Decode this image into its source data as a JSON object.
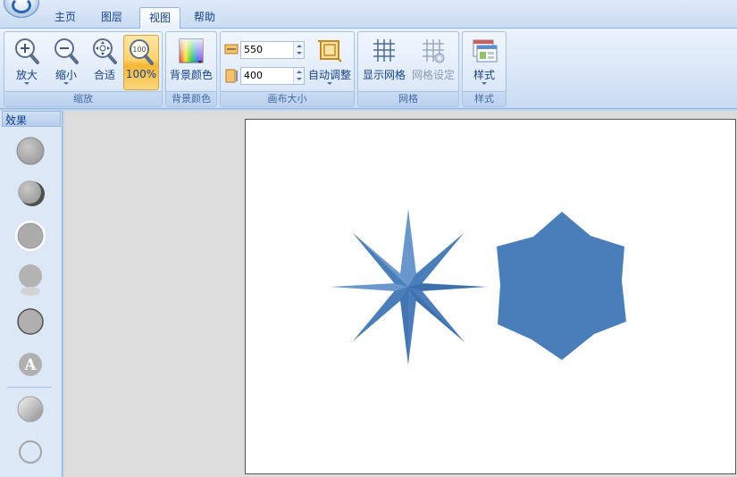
{
  "tabs": [
    {
      "label": "主页",
      "active": false
    },
    {
      "label": "图层",
      "active": false
    },
    {
      "label": "视图",
      "active": true
    },
    {
      "label": "帮助",
      "active": false
    }
  ],
  "ribbon": {
    "zoom_group": {
      "label": "缩放",
      "zoom_in": "放大",
      "zoom_out": "缩小",
      "fit": "合适",
      "actual": "100%"
    },
    "bg_group": {
      "label": "背景颜色",
      "button": "背景颜色"
    },
    "canvas_group": {
      "label": "画布大小",
      "width": "550",
      "height": "400",
      "auto_adjust": "自动调整"
    },
    "grid_group": {
      "label": "网格",
      "show_grid": "显示网格",
      "grid_settings": "网格设定"
    },
    "style_group": {
      "label": "样式",
      "button": "样式"
    }
  },
  "sidebar": {
    "title": "效果",
    "effects": [
      "plain",
      "shadow",
      "glow",
      "reflection",
      "outline",
      "text",
      "gradient",
      "ring"
    ]
  },
  "colors": {
    "shape_fill": "#4a7ebb",
    "canvas": "#ffffff",
    "workspace": "#dcdcdc"
  }
}
